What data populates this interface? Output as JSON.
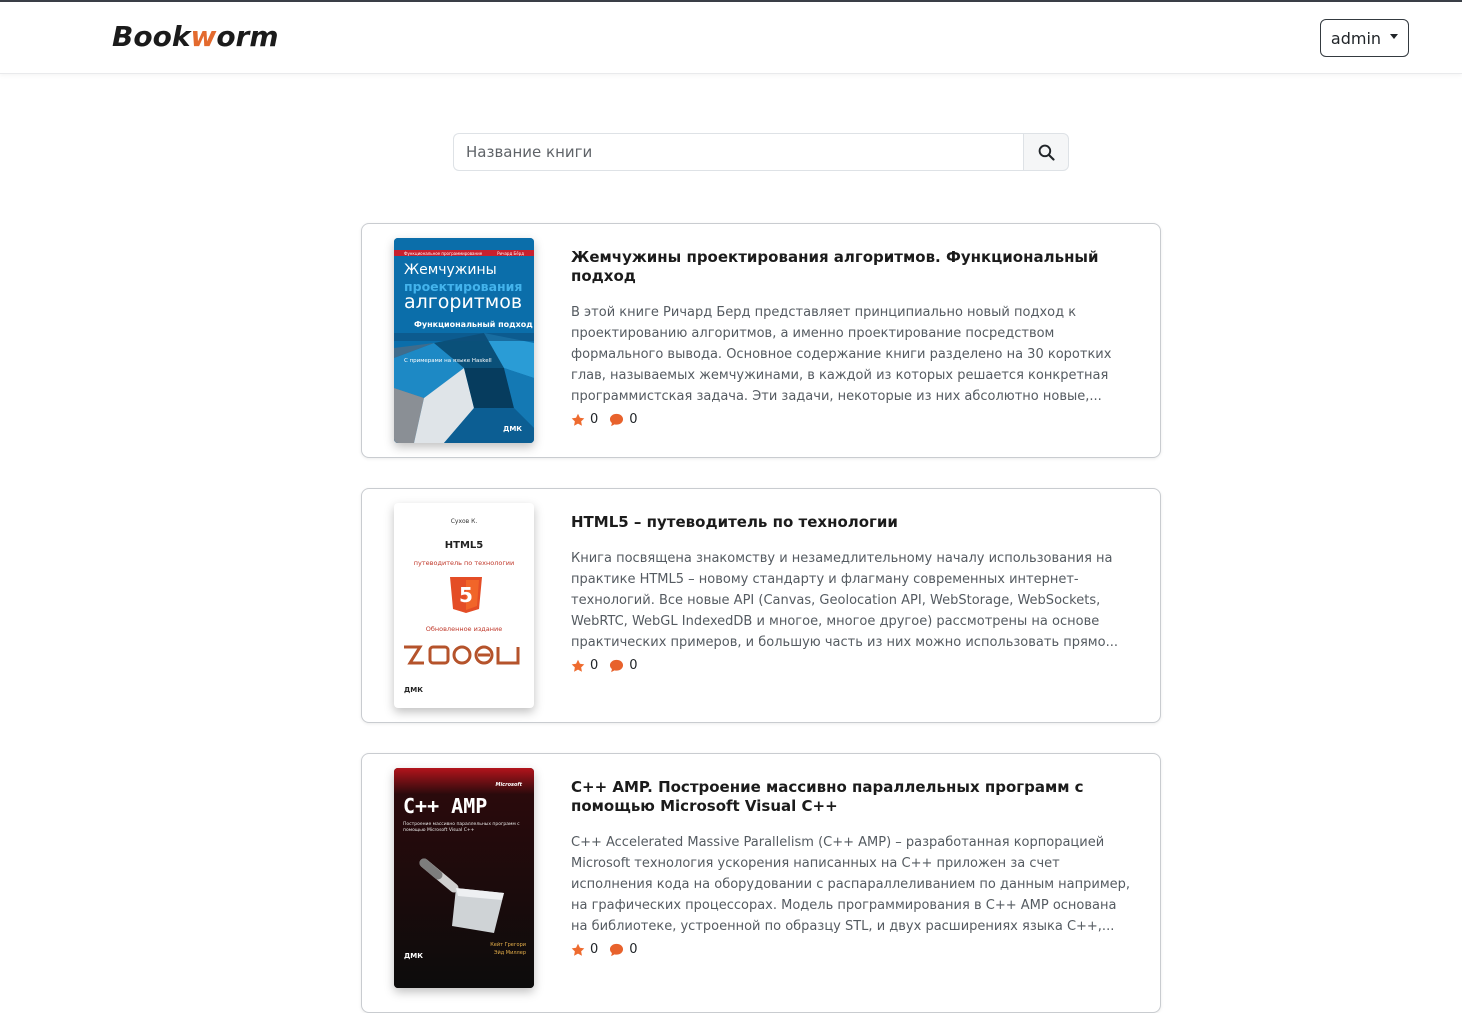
{
  "brand": {
    "part1": "Book",
    "part2": "w",
    "part3": "orm"
  },
  "user_menu": {
    "label": "admin"
  },
  "search": {
    "placeholder": "Название книги"
  },
  "books": [
    {
      "title": "Жемчужины проектирования алгоритмов. Функциональный подход",
      "description": "В этой книге Ричард Берд представляет принципиально новый подход к проектированию алгоритмов, а именно проектирование посредством формального вывода. Основное содержание книги разделено на 30 коротких глав, называемых жемчужинами, в каждой из которых решается конкретная программистская задача. Эти задачи, некоторые из них абсолютно новые,...",
      "rating": "0",
      "comments": "0",
      "cover": {
        "series": "Функциональное программирование",
        "author": "Ричард Бёрд",
        "line1": "Жемчужины",
        "line2": "проектирования",
        "line3": "алгоритмов",
        "subtitle": "Функциональный подход",
        "note": "С примерами на языке Haskell",
        "publisher": "ДМК"
      }
    },
    {
      "title": "HTML5 – путеводитель по технологии",
      "description": "Книга посвящена знакомству и незамедлительному началу использования на практике HTML5 – новому стандарту и флагману современных интернет-технологий. Все новые API (Canvas, Geolocation API, WebStorage, WebSockets, WebRTC, WebGL IndexedDB и многое, многое другое) рассмотрены на основе практических примеров, и большую часть из них можно использовать прямо...",
      "rating": "0",
      "comments": "0",
      "cover": {
        "author": "Сухов К.",
        "title": "HTML5",
        "subtitle": "путеводитель по технологии",
        "edition": "Обновленное издание",
        "publisher": "ДМК"
      }
    },
    {
      "title": "C++ AMP. Построение массивно параллельных программ с помощью Microsoft Visual C++",
      "description": "C++ Accelerated Massive Parallelism (C++ AMP) – разработанная корпорацией Microsoft технология ускорения написанных на C++ приложен за счет исполнения кода на оборудовании с распараллеливанием по данным например, на графических процессорах. Модель программирования в C++ AMP основана на библиотеке, устроенной по образцу STL, и двух расширениях языка C++,...",
      "rating": "0",
      "comments": "0",
      "cover": {
        "brand": "Microsoft",
        "title": "C++ AMP",
        "subtitle": "Построение массивно параллельных программ с помощью Microsoft Visual C++",
        "authors": "Кейт Грегори Эйд Миллер",
        "publisher": "ДМК"
      }
    }
  ],
  "colors": {
    "accent": "#e36a2e",
    "star": "#ee6b2f",
    "comment": "#e8622c"
  }
}
